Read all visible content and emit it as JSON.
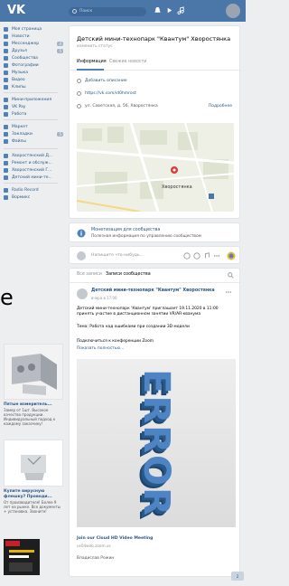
{
  "topbar": {
    "logo": "VK",
    "search_placeholder": "Поиск"
  },
  "sidebar": {
    "items": [
      {
        "label": "Моя страница",
        "icon": "home-icon"
      },
      {
        "label": "Новости",
        "icon": "news-icon"
      },
      {
        "label": "Мессенджер",
        "icon": "messenger-icon",
        "badge": "4"
      },
      {
        "label": "Друзья",
        "icon": "friends-icon",
        "badge": "5"
      },
      {
        "label": "Сообщества",
        "icon": "groups-icon"
      },
      {
        "label": "Фотографии",
        "icon": "photo-icon"
      },
      {
        "label": "Музыка",
        "icon": "music-icon"
      },
      {
        "label": "Видео",
        "icon": "video-icon"
      },
      {
        "label": "Клипы",
        "icon": "clips-icon"
      },
      {
        "label": "Мини-приложения",
        "icon": "apps-icon"
      },
      {
        "label": "VK Pay",
        "icon": "vkpay-icon"
      },
      {
        "label": "Работа",
        "icon": "work-icon"
      },
      {
        "label": "Маркет",
        "icon": "market-icon"
      },
      {
        "label": "Закладки",
        "icon": "bookmarks-icon",
        "badge": "5"
      },
      {
        "label": "Файлы",
        "icon": "files-icon"
      },
      {
        "label": "Хворостянский Д...",
        "icon": "group-link-icon"
      },
      {
        "label": "Ремонт и обслуж...",
        "icon": "group-link-icon"
      },
      {
        "label": "Хворостянский Г...",
        "icon": "group-link-icon"
      },
      {
        "label": "Детский мини-те...",
        "icon": "group-link-icon"
      },
      {
        "label": "Radio Record",
        "icon": "radio-icon"
      },
      {
        "label": "Вормикс",
        "icon": "game-icon"
      }
    ]
  },
  "ads": [
    {
      "title": "Пятые измеритель...",
      "subtitle": "",
      "text": "Замер от 1шт. Высокое качество продукции. Индивидуальный подход к каждому заказчику!"
    },
    {
      "title": "Купите вирусную флешку? Проводи...",
      "subtitle": "",
      "text": "От производителя! Более 9 лет на рынке. Все документы + установка. Звоните!"
    }
  ],
  "group": {
    "title": "Детский мини-технопарк \"Квантум\" Хворостянка",
    "status": "изменить статус",
    "tabs": [
      "Информация",
      "Свежие новости"
    ],
    "info": {
      "add_description": "Добавить описание",
      "link": "https://vk.com/id0hmrost",
      "address": "ул. Советская, д. 56, Хворостянка",
      "more": "Подробнее"
    },
    "map_label": "Хворостянка"
  },
  "monetize": {
    "title": "Монетизация для сообщества",
    "subtitle": "Полезная информация по управлению сообществом"
  },
  "compose": {
    "placeholder": "Напишите что-нибудь..."
  },
  "wall": {
    "tabs": [
      "Все записи",
      "Записи сообщества"
    ]
  },
  "post": {
    "author": "Детский мини-технопарк \"Квантум\" Хворостянка",
    "time": "вчера в 17:00",
    "text1": "Детский мини-технопарк 'Квантум' приглашает 19.11.2020 в 11:00 принять участие в дистанционном занятии VR/AR-кванума",
    "text2": "Тема: Работа над ошибками при создании 3D модели",
    "text3": "Подключиться к конференции Zoom",
    "show_more": "Показать полностью...",
    "image_text": "ERROR",
    "link_title": "Join our Cloud HD Video Meeting",
    "link_domain": "us04web.zoom.us",
    "signature": "Владислав Рожин"
  },
  "ghost_letter": "е",
  "corner_button": "2"
}
